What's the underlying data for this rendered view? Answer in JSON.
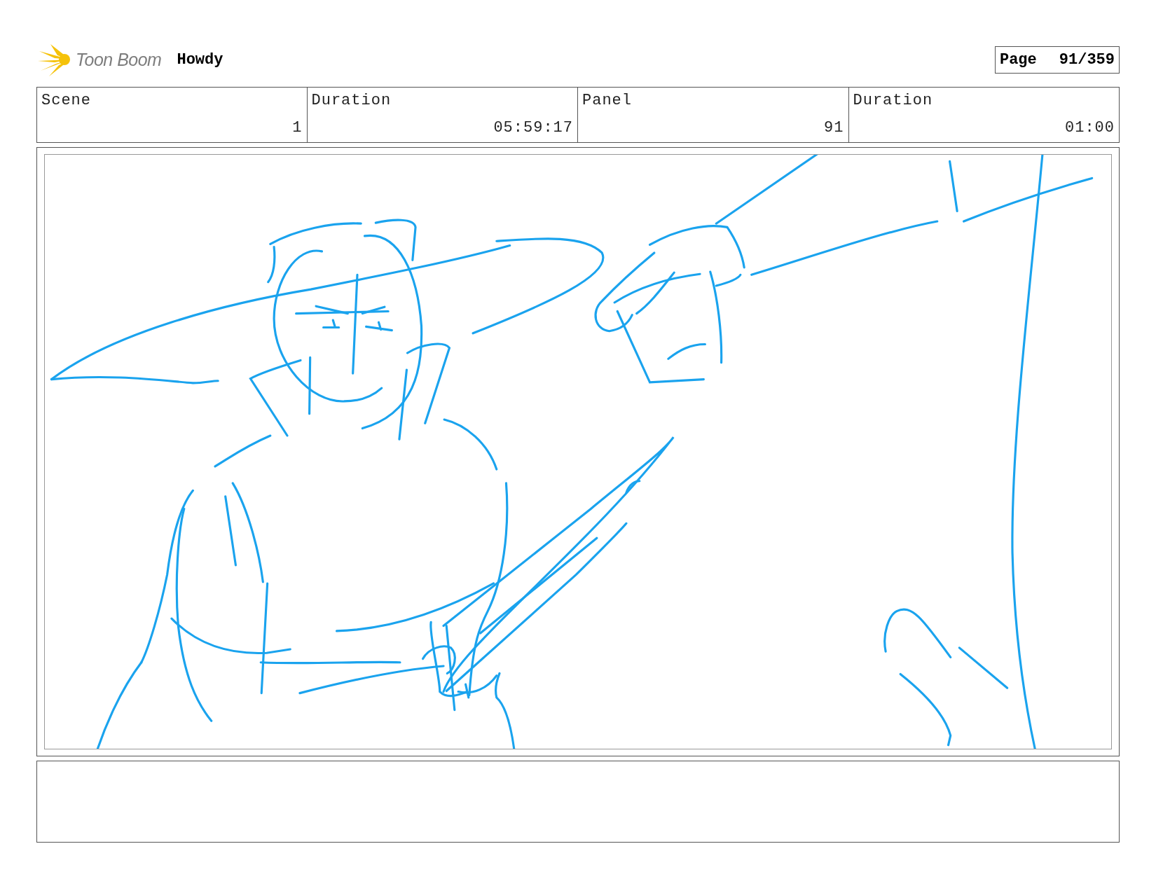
{
  "logo": {
    "text": "Toon Boom"
  },
  "project": {
    "title": "Howdy"
  },
  "page": {
    "label": "Page",
    "number": "91/359"
  },
  "table": {
    "columns": [
      "Scene",
      "Duration",
      "Panel",
      "Duration"
    ],
    "rows": [
      [
        "1",
        "05:59:17",
        "91",
        "01:00"
      ]
    ]
  }
}
